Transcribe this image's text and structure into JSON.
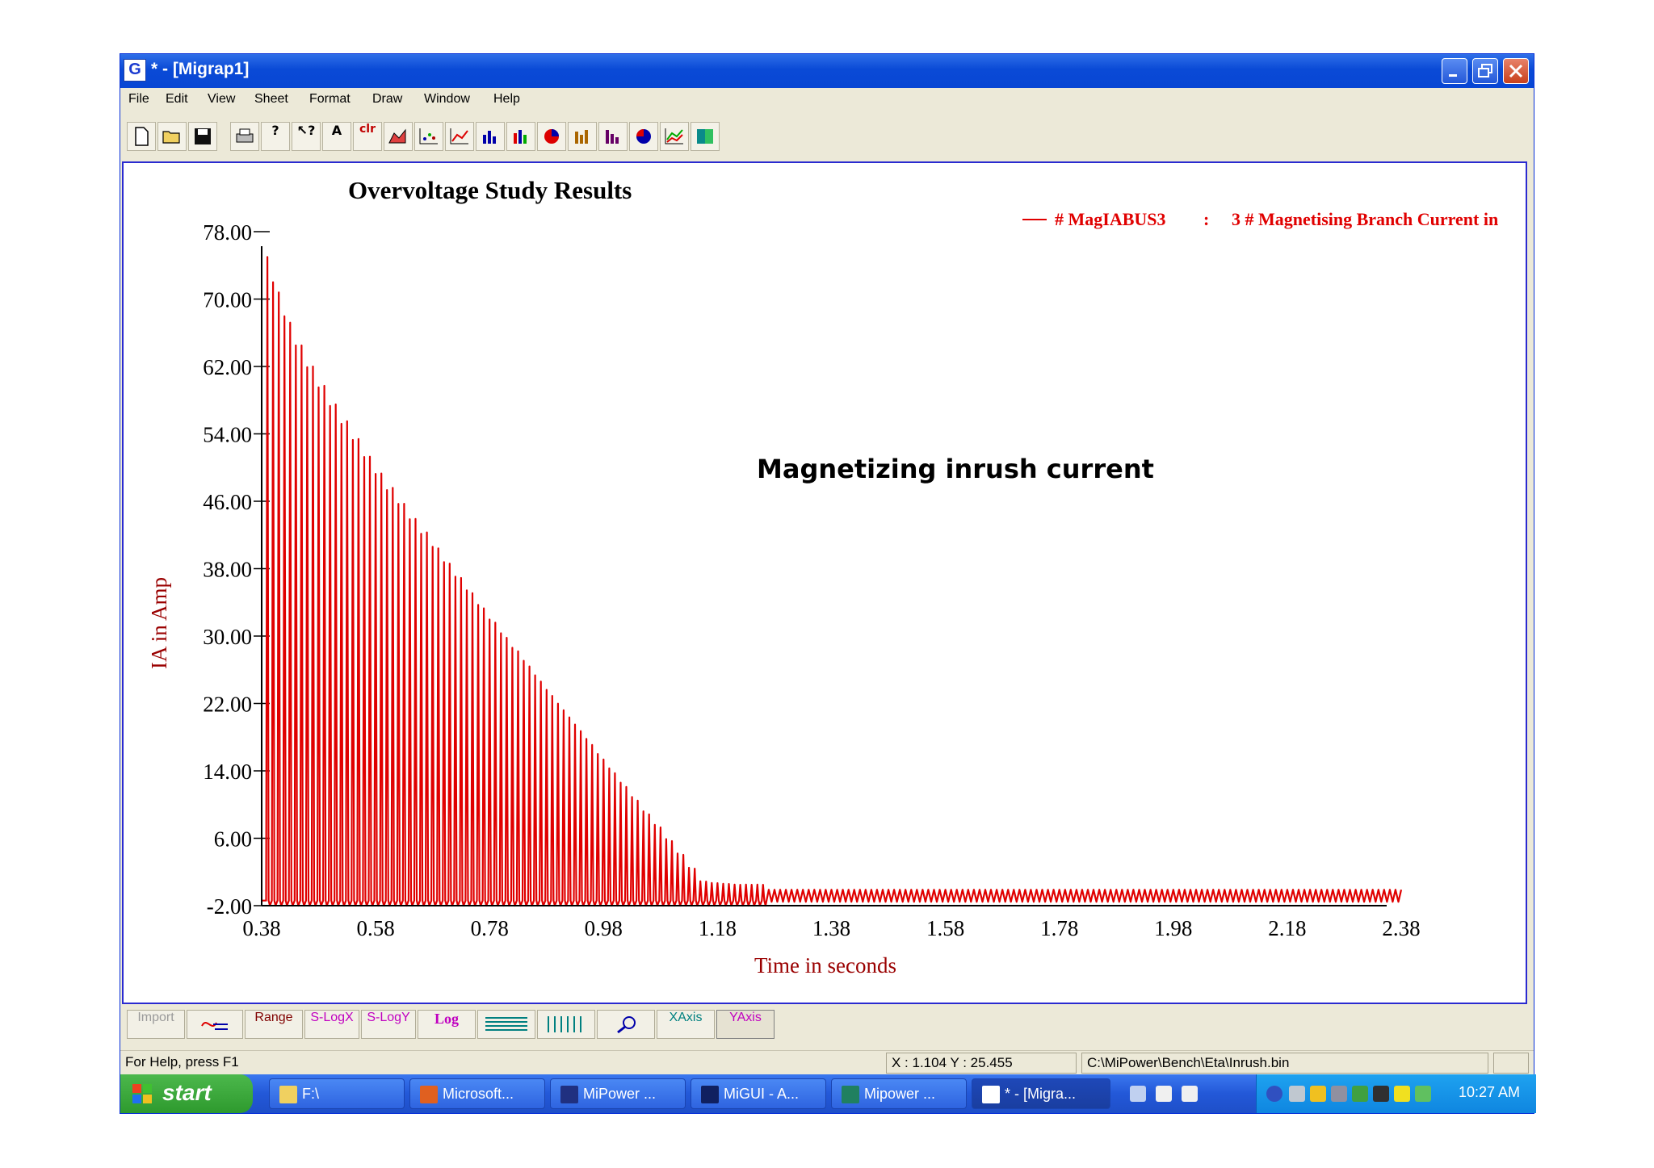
{
  "window": {
    "title": "* - [Migrap1]",
    "app_icon": "G"
  },
  "menu": [
    "File",
    "Edit",
    "View",
    "Sheet",
    "Format",
    "Draw",
    "Window",
    "Help"
  ],
  "toolbar": {
    "icons": [
      "new-doc-icon",
      "open-folder-icon",
      "save-icon",
      "print-icon",
      "help-icon",
      "context-help-icon",
      "text-icon",
      "clr",
      "area-chart-icon",
      "scatter-chart-icon",
      "line-chart-icon",
      "bar-chart-icon",
      "bar-chart-2-icon",
      "pie-chart-icon",
      "bar-chart-3-icon",
      "bar-chart-4-icon",
      "pie-chart-2-icon",
      "line-chart-2-icon",
      "table-icon"
    ],
    "text_label": "A",
    "clr_label": "clr"
  },
  "chart_data": {
    "type": "line",
    "title": "Overvoltage Study Results",
    "annotation": "Magnetizing inrush current",
    "legend": {
      "series": "# MagIABUS3",
      "separator": ":",
      "description": "3 # Magnetising Branch Current in",
      "placement": "top-right",
      "color": "#e00000"
    },
    "xlabel": "Time in seconds",
    "ylabel": "IA in Amp",
    "xlim": [
      0.38,
      2.38
    ],
    "ylim": [
      -2.0,
      78.0
    ],
    "x_ticks": [
      "0.38",
      "0.58",
      "0.78",
      "0.98",
      "1.18",
      "1.38",
      "1.58",
      "1.78",
      "1.98",
      "2.18",
      "2.38"
    ],
    "y_ticks": [
      "78.00",
      "70.00",
      "62.00",
      "54.00",
      "46.00",
      "38.00",
      "30.00",
      "22.00",
      "14.00",
      "6.00",
      "-2.00"
    ],
    "frequency_hz": 50,
    "peak_times": [
      0.39,
      0.41,
      0.43,
      0.45,
      0.47,
      0.49,
      0.51,
      0.53,
      0.55,
      0.57,
      0.59,
      0.61,
      0.63,
      0.65,
      0.67,
      0.69,
      0.71,
      0.73,
      0.75,
      0.77,
      0.79,
      0.81,
      0.83,
      0.85,
      0.87,
      0.89,
      0.91,
      0.93,
      0.95,
      0.97,
      0.99,
      1.01,
      1.03,
      1.05,
      1.07,
      1.09,
      1.11,
      1.13,
      1.15,
      1.17,
      1.19,
      1.21,
      1.23,
      1.25
    ],
    "peak_values": [
      75.0,
      70.8,
      67.2,
      64.5,
      62.0,
      59.7,
      57.5,
      55.5,
      53.4,
      51.3,
      49.3,
      47.6,
      45.7,
      43.9,
      42.3,
      40.4,
      38.6,
      36.9,
      35.1,
      33.3,
      31.6,
      29.8,
      28.2,
      26.4,
      24.6,
      22.9,
      21.2,
      19.5,
      17.8,
      16.0,
      14.3,
      12.6,
      10.9,
      9.2,
      7.6,
      5.9,
      4.2,
      2.5,
      0.9,
      0.7,
      0.6,
      0.5,
      0.5,
      0.5
    ],
    "second_peak_offset": 0.01,
    "second_peak_ratio": 0.96,
    "steady_amplitude": 0.9,
    "x_end": 2.38,
    "line_color": "#e00000"
  },
  "bottom_toolbar": {
    "import": "Import",
    "range": "Range",
    "slogx": "S-LogX",
    "slogy": "S-LogY",
    "log": "Log",
    "xaxis": "XAxis",
    "yaxis": "YAxis"
  },
  "statusbar": {
    "help": "For Help, press F1",
    "coords": "X :  1.104   Y : 25.455",
    "path": "C:\\MiPower\\Bench\\Eta\\Inrush.bin"
  },
  "taskbar": {
    "start": "start",
    "tasks": [
      {
        "label": "F:\\",
        "icon": "folder-icon"
      },
      {
        "label": "Microsoft...",
        "icon": "powerpoint-icon"
      },
      {
        "label": "MiPower ...",
        "icon": "mipower-icon"
      },
      {
        "label": "MiGUI - A...",
        "icon": "migui-icon"
      },
      {
        "label": "Mipower ...",
        "icon": "mipower-2-icon"
      },
      {
        "label": "* - [Migra...",
        "icon": "migrap-icon"
      }
    ],
    "clock": "10:27 AM"
  }
}
